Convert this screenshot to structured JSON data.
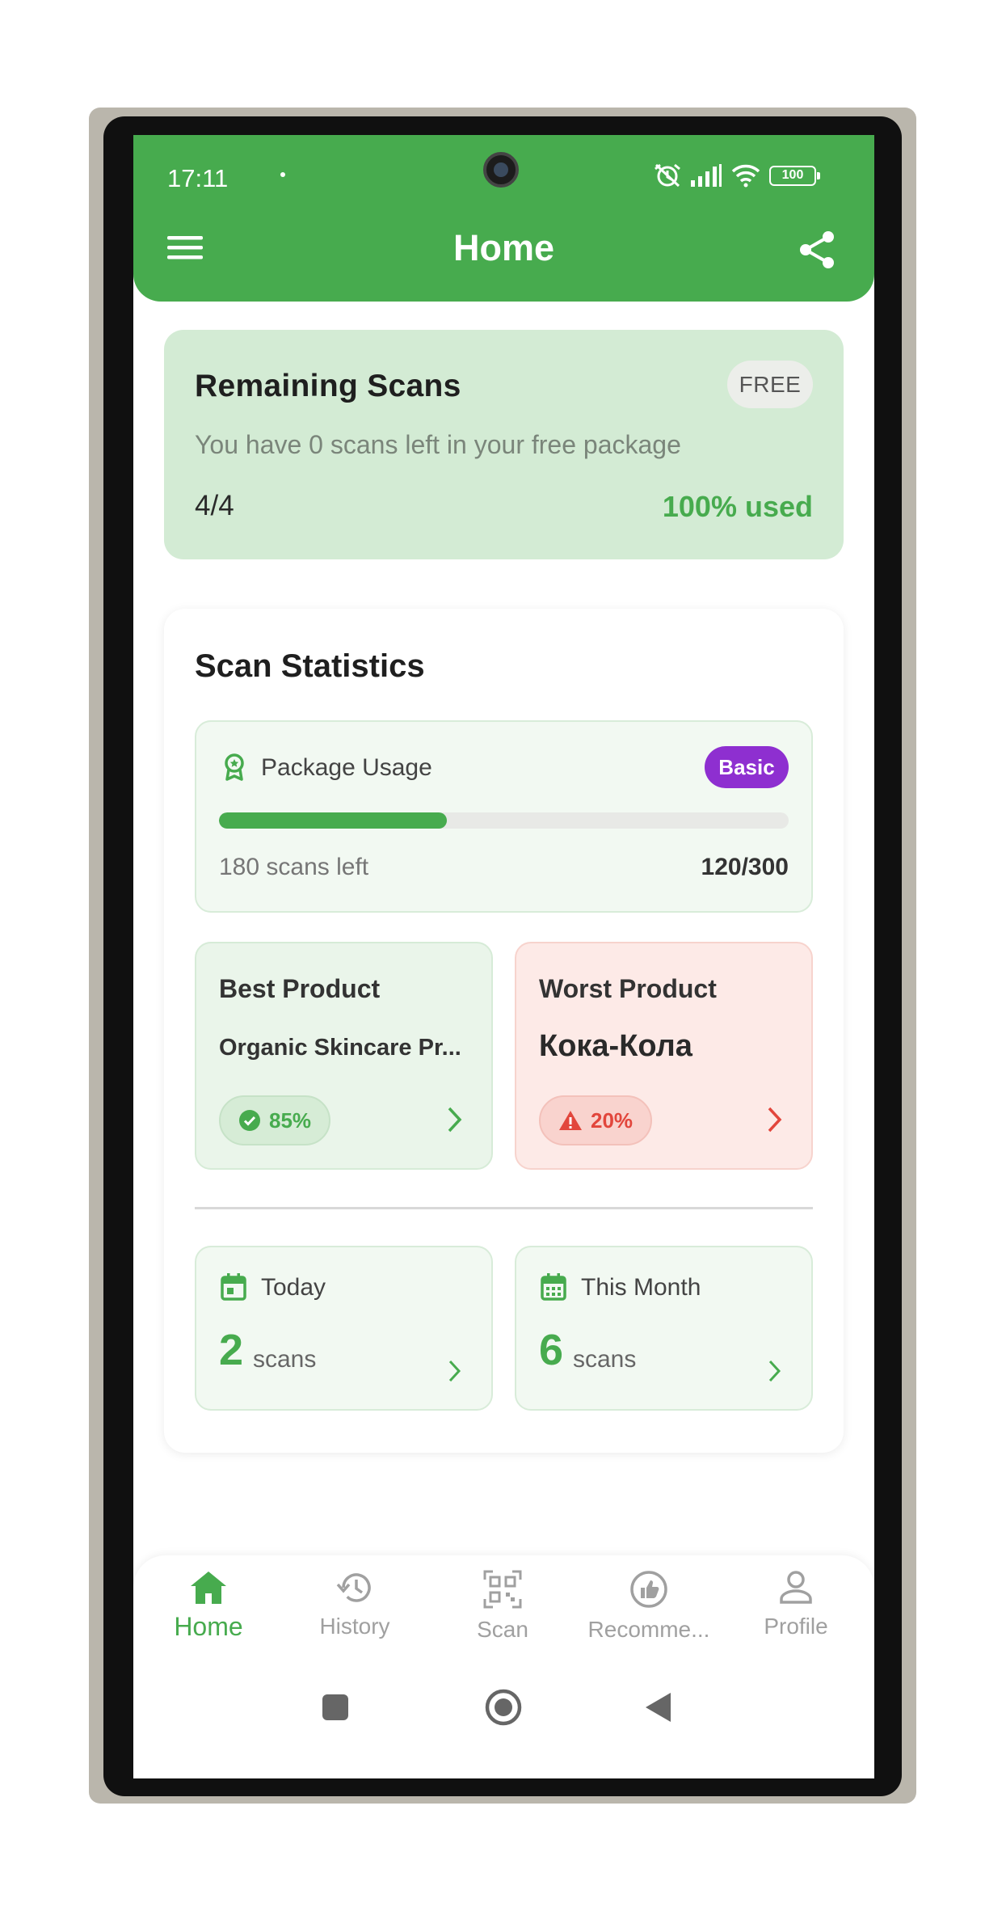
{
  "status_bar": {
    "time": "17:11",
    "battery": "100"
  },
  "app_bar": {
    "title": "Home"
  },
  "remaining_scans": {
    "title": "Remaining Scans",
    "badge": "FREE",
    "subtitle": "You have 0 scans left in your free package",
    "count": "4/4",
    "used": "100% used"
  },
  "statistics": {
    "title": "Scan Statistics",
    "package": {
      "label": "Package Usage",
      "badge": "Basic",
      "progress_fraction": 0.4,
      "scans_left": "180 scans left",
      "usage": "120/300"
    },
    "best_product": {
      "heading": "Best Product",
      "name": "Organic Skincare Pr...",
      "score": "85%"
    },
    "worst_product": {
      "heading": "Worst Product",
      "name": "Кока-Кола",
      "score": "20%"
    },
    "today": {
      "label": "Today",
      "count": "2",
      "unit": "scans"
    },
    "month": {
      "label": "This Month",
      "count": "6",
      "unit": "scans"
    }
  },
  "bottom_nav": {
    "items": [
      {
        "label": "Home",
        "icon": "home-icon",
        "active": true
      },
      {
        "label": "History",
        "icon": "history-icon",
        "active": false
      },
      {
        "label": "Scan",
        "icon": "qr-scan-icon",
        "active": false
      },
      {
        "label": "Recomme...",
        "icon": "recommend-icon",
        "active": false
      },
      {
        "label": "Profile",
        "icon": "person-icon",
        "active": false
      }
    ]
  },
  "colors": {
    "brand_green": "#47ab4e",
    "danger_red": "#e2463c",
    "basic_purple": "#8e2fd0"
  }
}
